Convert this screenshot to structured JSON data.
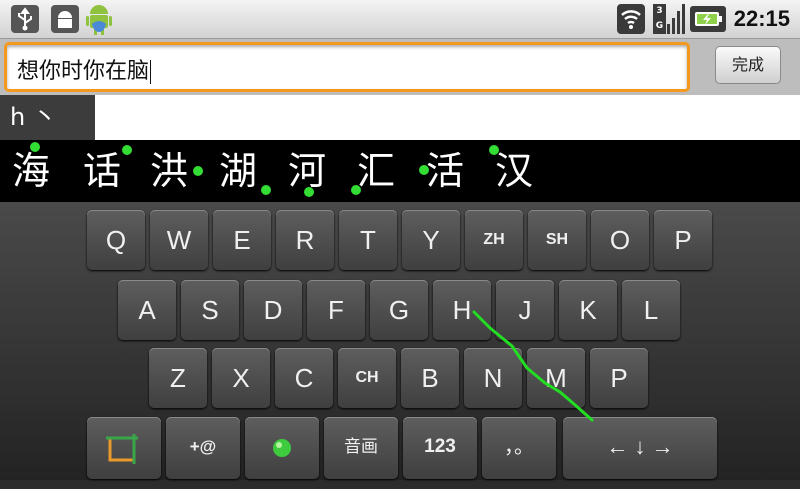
{
  "status_bar": {
    "left_icons": [
      "usb-icon",
      "android-debug-icon",
      "android-mascot-icon"
    ],
    "right_icons": [
      "wifi-icon",
      "3g-signal-icon",
      "battery-charging-icon"
    ],
    "network_label": "3G",
    "time": "22:15"
  },
  "input": {
    "value": "想你时你在脑",
    "done_label": "完成"
  },
  "composing": {
    "pinyin": "h 丶"
  },
  "candidates": [
    "海",
    "话",
    "洪",
    "湖",
    "河",
    "汇",
    "活",
    "汉"
  ],
  "keyboard": {
    "row1": [
      "Q",
      "W",
      "E",
      "R",
      "T",
      "Y",
      "ZH",
      "SH",
      "O",
      "P"
    ],
    "row2": [
      "A",
      "S",
      "D",
      "F",
      "G",
      "H",
      "J",
      "K",
      "L"
    ],
    "row3": [
      "Z",
      "X",
      "C",
      "CH",
      "B",
      "N",
      "M",
      "P"
    ],
    "bottom": {
      "settings_icon": "crop-frame-icon",
      "symbols_label": "+@",
      "gem_icon": "green-gem-icon",
      "voice_label": "音画",
      "numbers_label": "123",
      "punct_label": "，。",
      "arrows_label": "← ↓ →"
    }
  },
  "colors": {
    "textbox_border": "#f39a1e",
    "swipe_trail": "#22dd22",
    "candidate_bg": "#000000"
  }
}
